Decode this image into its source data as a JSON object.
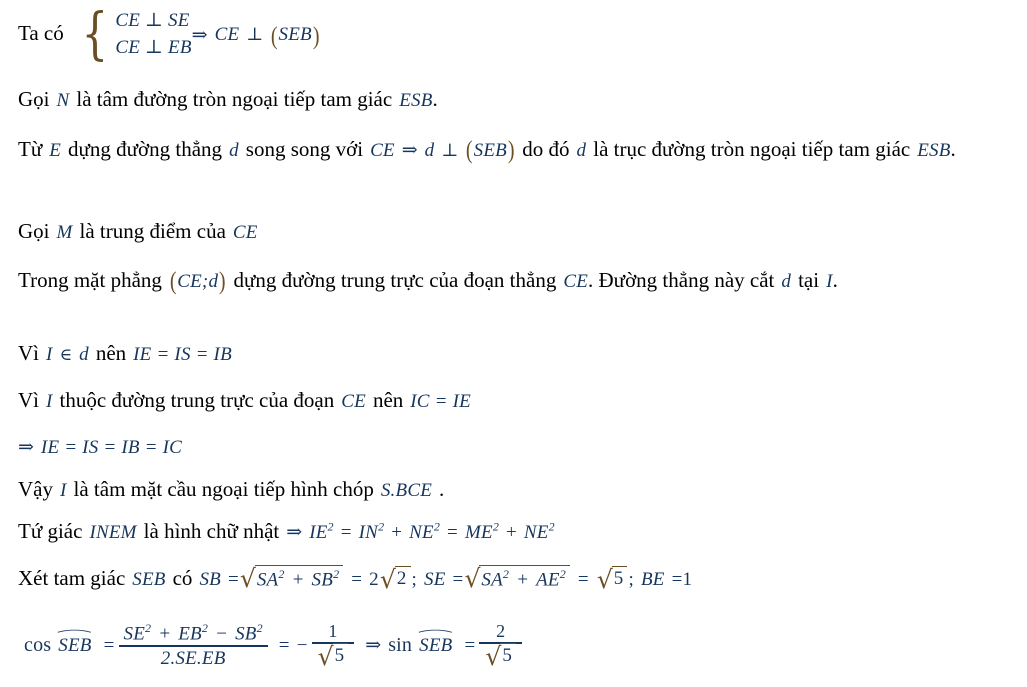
{
  "document": {
    "language": "Vietnamese",
    "subject": "Hinh hoc khong gian - mat cau ngoai tiep",
    "text_color": "#000000",
    "math_color": "#17365d",
    "operator_color": "#6b4f23",
    "background_color": "#ffffff"
  },
  "lines": {
    "l1": {
      "lead": "Ta có",
      "sys_row1": "CE ⊥ SE",
      "sys_row2": "CE ⊥ EB",
      "implies": "⇒",
      "result_prefix": "CE",
      "result_perp": "⊥",
      "result_plane": "SEB",
      "paren_open": "(",
      "paren_close": ")",
      "brace": "{"
    },
    "l2": {
      "goi": "Gọi",
      "point": "N",
      "body": "là tâm đường tròn ngoại tiếp tam giác",
      "triangle": "ESB",
      "period": "."
    },
    "l3": {
      "tu": "Từ",
      "point_e": "E",
      "body1": "dựng đường thẳng",
      "line_d": "d",
      "body2": "song song với",
      "seg_ce": "CE",
      "implies": "⇒",
      "d2": "d",
      "perp": "⊥",
      "plane": "SEB",
      "body3": "do đó",
      "d3": "d",
      "body4": "là trục đường tròn ngoại tiếp tam giác",
      "triangle": "ESB",
      "period": "."
    },
    "l4": {
      "goi": "Gọi",
      "point": "M",
      "body": "là trung điểm của",
      "seg": "CE"
    },
    "l5": {
      "body1": "Trong mặt phẳng",
      "plane": "CE;d",
      "body2": "dựng đường trung trực của đoạn thẳng",
      "seg": "CE",
      "body3": ". Đường thẳng này cắt",
      "line_d": "d",
      "body4": "tại",
      "point_i": "I",
      "period": "."
    },
    "l6": {
      "vi": "Vì",
      "point_i": "I",
      "belongs": "∈",
      "line_d": "d",
      "nen": "nên",
      "eq": "IE = IS = IB"
    },
    "l7": {
      "vi": "Vì",
      "point_i": "I",
      "body": "thuộc đường trung trực của đoạn",
      "seg": "CE",
      "nen": "nên",
      "eq": "IC = IE"
    },
    "l8": {
      "implies": "⇒",
      "eq": "IE = IS = IB = IC"
    },
    "l9": {
      "vay": "Vậy",
      "point_i": "I",
      "body": "là tâm mặt cầu ngoại tiếp hình chóp",
      "solid": "S.BCE",
      "period": "."
    },
    "l10": {
      "body1": "Tứ giác",
      "quad": "INEM",
      "body2": "là hình chữ nhật",
      "implies": "⇒",
      "eq_a": "IE",
      "eq_b": "IN",
      "eq_c": "NE",
      "eq_d": "ME",
      "eq_e": "NE",
      "exp": "2",
      "equals": "=",
      "plus": "+"
    },
    "l11": {
      "body1": "Xét tam giác",
      "triangle": "SEB",
      "co": "có",
      "sb_label": "SB",
      "sb_rad": "SA² + SB²",
      "sb_rad_a": "SA",
      "sb_rad_b": "SB",
      "sb_value_coeff": "2",
      "sb_value_rad": "2",
      "se_label": "SE",
      "se_rad_a": "SA",
      "se_rad_b": "AE",
      "se_value_rad": "5",
      "be_label": "BE",
      "be_value": "1",
      "exp": "2",
      "equals": "=",
      "plus": "+",
      "semi": ";"
    },
    "l12": {
      "cos": "cos",
      "angle": "SEB",
      "equals": "=",
      "numer_a": "SE",
      "numer_b": "EB",
      "numer_c": "SB",
      "exp": "2",
      "plus": "+",
      "minus": "−",
      "denom": "2.SE.EB",
      "minus_sign": "−",
      "frac2_num": "1",
      "frac2_den_rad": "5",
      "implies": "⇒",
      "sin": "sin",
      "angle2": "SEB",
      "frac3_num": "2",
      "frac3_den_rad": "5",
      "hat": "⌒",
      "radical": "√"
    }
  }
}
